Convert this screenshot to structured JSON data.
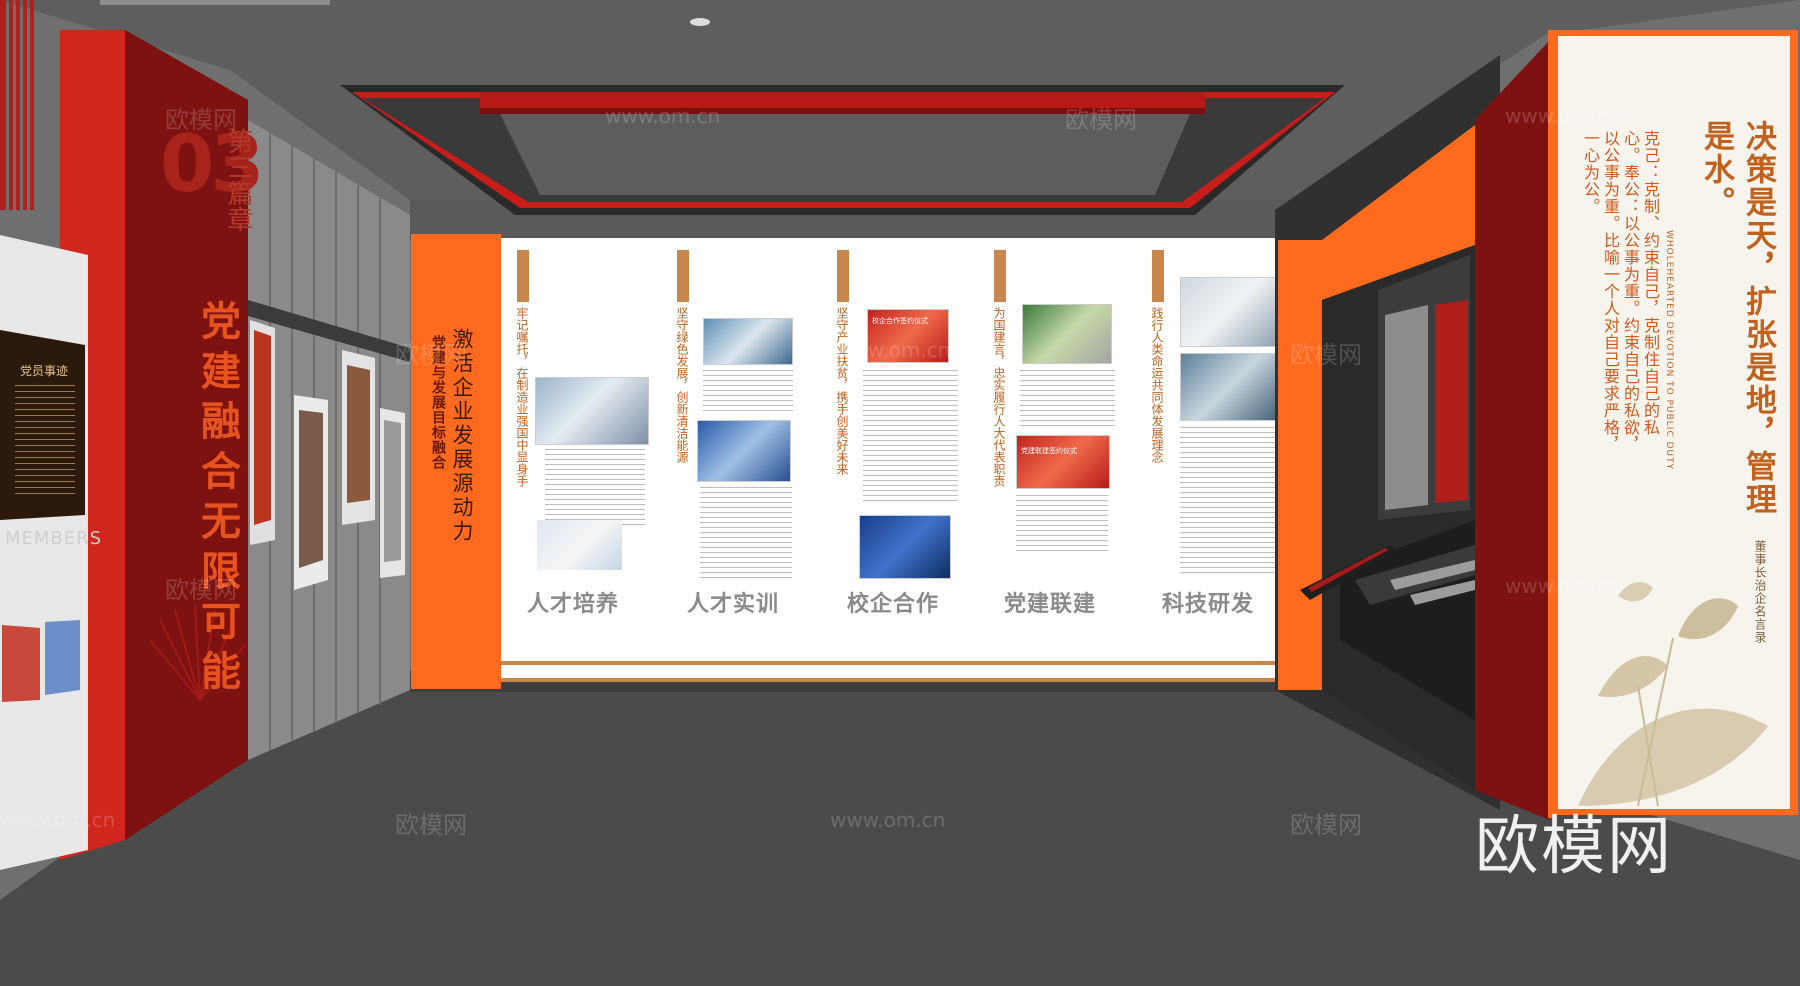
{
  "left_wall": {
    "chapter_number": "03",
    "chapter_label": "第三篇章",
    "chapter_title": "党建融合无限可能",
    "board_heading": "党员事迹",
    "members_text": "MEMBERS"
  },
  "center_panel": {
    "slogan": "激活企业发展源动力",
    "sub_slogan": "党建与发展目标融合",
    "columns": [
      {
        "vertical_text": "牢记嘱托，在制造业强国中显身手",
        "title": "人才培养"
      },
      {
        "vertical_text": "坚守绿色发展，创新清洁能源",
        "title": "人才实训"
      },
      {
        "vertical_text": "坚守产业扶贫，携手创美好未来",
        "title": "校企合作"
      },
      {
        "vertical_text": "为国建言，忠实履行人大代表职责",
        "title": "党建联建"
      },
      {
        "vertical_text": "践行人类命运共同体发展理念",
        "title": "科技研发"
      }
    ],
    "photo_captions": [
      "校企合作签约仪式",
      "党建联建签约仪式"
    ]
  },
  "right_wall": {
    "quote_main": "决策是天，扩张是地，管理是水。",
    "quote_english": "WHOLEHEARTED DEVOTION TO PUBLIC DUTY",
    "explanation": "克己：克制、约束自己，克制住自己的私心。奉公：以公事为重。约束自己的私欲，以公事为重。比喻一个人对自己要求严格，一心为公。",
    "attribution": "董事长治企名言录"
  },
  "watermarks": {
    "cn": "欧模网",
    "en": "www.om.cn",
    "brand": "欧模网"
  },
  "colors": {
    "orange": "#ff6a1f",
    "dark_red": "#8c1210",
    "red": "#c81d19",
    "floor": "#4d4d4d",
    "ceiling": "#5e5e5e"
  }
}
